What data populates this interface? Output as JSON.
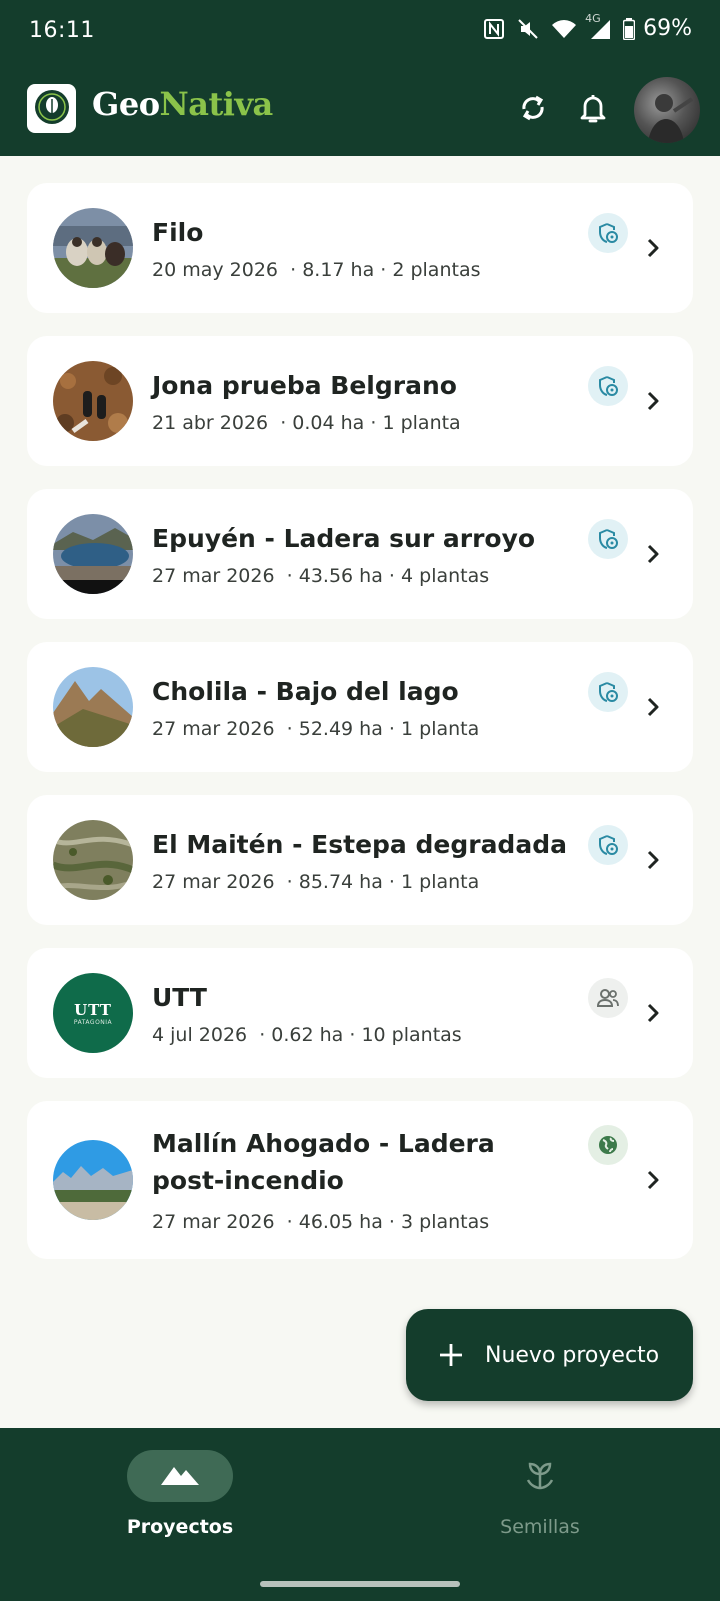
{
  "status_bar": {
    "time": "16:11",
    "network": "4G",
    "battery": "69%"
  },
  "app_bar": {
    "brand_part1": "Geo",
    "brand_part2": "Nativa",
    "colors": {
      "primary": "#143d2c",
      "accent": "#8bc34a"
    },
    "icons": [
      "tree-logo-icon",
      "sync-icon",
      "bell-icon",
      "avatar"
    ]
  },
  "projects": [
    {
      "title": "Filo",
      "date": "20 may 2026",
      "area": "8.17 ha",
      "plants": "2 plantas",
      "visibility": "private",
      "thumb": "sheep-photo"
    },
    {
      "title": "Jona prueba Belgrano",
      "date": "21 abr 2026",
      "area": "0.04 ha",
      "plants": "1 planta",
      "visibility": "private",
      "thumb": "boots-leaves-photo"
    },
    {
      "title": "Epuyén - Ladera sur arroyo",
      "date": "27 mar 2026",
      "area": "43.56 ha",
      "plants": "4 plantas",
      "visibility": "private",
      "thumb": "lake-photo"
    },
    {
      "title": "Cholila - Bajo del lago",
      "date": "27 mar 2026",
      "area": "52.49 ha",
      "plants": "1 planta",
      "visibility": "private",
      "thumb": "mountain-photo"
    },
    {
      "title": "El Maitén - Estepa degradada",
      "date": "27 mar 2026",
      "area": "85.74 ha",
      "plants": "1 planta",
      "visibility": "private",
      "thumb": "steppe-aerial-photo"
    },
    {
      "title": "UTT",
      "date": "4 jul 2026",
      "area": "0.62 ha",
      "plants": "10 plantas",
      "visibility": "shared",
      "thumb": "utt-logo",
      "thumb_text": "UTT",
      "thumb_subtext": "PATAGONIA"
    },
    {
      "title": "Mallín Ahogado - Ladera post-incendio",
      "date": "27 mar 2026",
      "area": "46.05 ha",
      "plants": "3 plantas",
      "visibility": "public",
      "thumb": "valley-photo"
    }
  ],
  "fab": {
    "label": "Nuevo proyecto"
  },
  "bottom_nav": {
    "items": [
      {
        "label": "Proyectos",
        "active": true,
        "icon": "mountains-icon"
      },
      {
        "label": "Semillas",
        "active": false,
        "icon": "sprout-icon"
      }
    ]
  }
}
